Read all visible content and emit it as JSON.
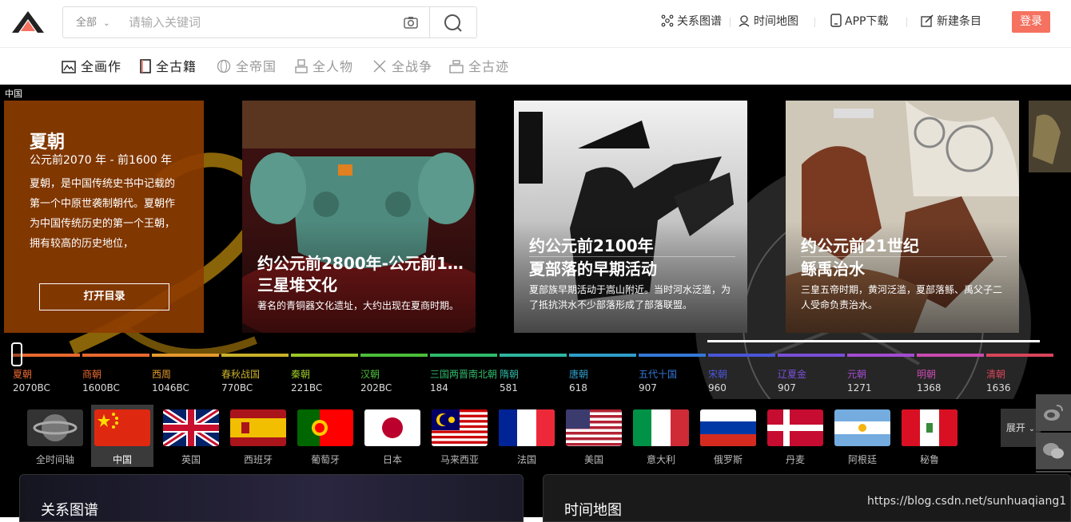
{
  "header": {
    "search_scope": "全部",
    "search_placeholder": "请输入关键词",
    "links": [
      {
        "label": "关系图谱",
        "icon": "graph-icon"
      },
      {
        "label": "时间地图",
        "icon": "map-pin-icon"
      },
      {
        "label": "APP下载",
        "icon": "phone-icon"
      },
      {
        "label": "新建条目",
        "icon": "edit-icon"
      }
    ],
    "login_label": "登录"
  },
  "categories": [
    {
      "label": "全画作",
      "icon": "painting-icon",
      "active": true
    },
    {
      "label": "全古籍",
      "icon": "book-icon",
      "active": true
    },
    {
      "label": "全帝国",
      "icon": "globe-icon",
      "active": false
    },
    {
      "label": "全人物",
      "icon": "person-icon",
      "active": false
    },
    {
      "label": "全战争",
      "icon": "swords-icon",
      "active": false
    },
    {
      "label": "全古迹",
      "icon": "monument-icon",
      "active": false
    }
  ],
  "hero": {
    "region_label": "中国",
    "intro": {
      "title": "夏朝",
      "period": "公元前2070 年 - 前1600 年",
      "description": "夏朝，是中国传统史书中记载的第一个中原世袭制朝代。夏朝作为中国传统历史的第一个王朝，拥有较高的历史地位，",
      "button_label": "打开目录"
    },
    "cards": [
      {
        "title_line1": "约公元前2800年-公元前110…",
        "title_line2": "三星堆文化",
        "description": "著名的青铜器文化遗址，大约出现在夏商时期。"
      },
      {
        "title_line1": "约公元前2100年",
        "title_line2": "夏部落的早期活动",
        "description": "夏部族早期活动于嵩山附近。当时河水泛滥，为了抵抗洪水不少部落形成了部落联盟。"
      },
      {
        "title_line1": "约公元前21世纪",
        "title_line2": "鲧禹治水",
        "description": "三皇五帝时期，黄河泛滥，夏部落鲧、禹父子二人受命负责治水。"
      }
    ]
  },
  "timeline": [
    {
      "name": "夏朝",
      "year": "2070BC",
      "color": "#e8692f"
    },
    {
      "name": "商朝",
      "year": "1600BC",
      "color": "#e8692f"
    },
    {
      "name": "西周",
      "year": "1046BC",
      "color": "#e59a2e"
    },
    {
      "name": "春秋战国",
      "year": "770BC",
      "color": "#c9b22a"
    },
    {
      "name": "秦朝",
      "year": "221BC",
      "color": "#9bc72a"
    },
    {
      "name": "汉朝",
      "year": "202BC",
      "color": "#4bbf3a"
    },
    {
      "name": "三国两晋南北朝",
      "year": "184",
      "color": "#2fba6b"
    },
    {
      "name": "隋朝",
      "year": "581",
      "color": "#2fb5a0"
    },
    {
      "name": "唐朝",
      "year": "618",
      "color": "#2f9ec9"
    },
    {
      "name": "五代十国",
      "year": "907",
      "color": "#3478d6"
    },
    {
      "name": "宋朝",
      "year": "960",
      "color": "#4a55d8"
    },
    {
      "name": "辽夏金",
      "year": "907",
      "color": "#7a4fd8"
    },
    {
      "name": "元朝",
      "year": "1271",
      "color": "#a34bd0"
    },
    {
      "name": "明朝",
      "year": "1368",
      "color": "#c94bb0"
    },
    {
      "name": "清朝",
      "year": "1636",
      "color": "#d8455a"
    }
  ],
  "countries": [
    {
      "name": "全时间轴",
      "flag": "globe"
    },
    {
      "name": "中国",
      "flag": "china",
      "active": true
    },
    {
      "name": "英国",
      "flag": "uk"
    },
    {
      "name": "西班牙",
      "flag": "spain"
    },
    {
      "name": "葡萄牙",
      "flag": "portugal"
    },
    {
      "name": "日本",
      "flag": "japan"
    },
    {
      "name": "马来西亚",
      "flag": "malaysia"
    },
    {
      "name": "法国",
      "flag": "france"
    },
    {
      "name": "美国",
      "flag": "usa"
    },
    {
      "name": "意大利",
      "flag": "italy"
    },
    {
      "name": "俄罗斯",
      "flag": "russia"
    },
    {
      "name": "丹麦",
      "flag": "denmark"
    },
    {
      "name": "阿根廷",
      "flag": "argentina"
    },
    {
      "name": "秘鲁",
      "flag": "peru"
    }
  ],
  "expand_label": "展开",
  "bottom": {
    "panel1_title": "关系图谱",
    "panel2_title": "时间地图",
    "watermark": "https://blog.csdn.net/sunhuaqiang1"
  },
  "colors": {
    "accent": "#f57160",
    "intro_bg": "#8c3c00"
  }
}
